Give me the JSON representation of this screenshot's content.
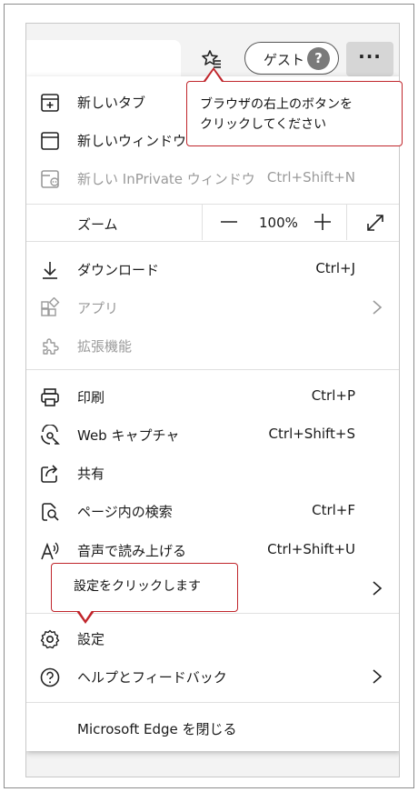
{
  "toolbar": {
    "favorites_icon": "favorites-star-icon",
    "profile_label": "ゲスト",
    "avatar_glyph": "?",
    "more_label": "···"
  },
  "menu": {
    "new_tab": "新しいタブ",
    "new_window": "新しいウィンドウ",
    "new_inprivate": "新しい InPrivate ウィンドウ",
    "new_inprivate_shortcut": "Ctrl+Shift+N",
    "zoom_label": "ズーム",
    "zoom_value": "100%",
    "downloads": "ダウンロード",
    "downloads_shortcut": "Ctrl+J",
    "apps": "アプリ",
    "extensions": "拡張機能",
    "print": "印刷",
    "print_shortcut": "Ctrl+P",
    "web_capture": "Web キャプチャ",
    "web_capture_shortcut": "Ctrl+Shift+S",
    "share": "共有",
    "find": "ページ内の検索",
    "find_shortcut": "Ctrl+F",
    "read_aloud": "音声で読み上げる",
    "read_aloud_shortcut": "Ctrl+Shift+U",
    "settings": "設定",
    "help": "ヘルプとフィードバック",
    "close_edge": "Microsoft Edge を閉じる"
  },
  "callouts": {
    "top_line1": "ブラウザの右上のボタンを",
    "top_line2": "クリックしてください",
    "settings": "設定をクリックします"
  },
  "colors": {
    "callout_border": "#c0252b",
    "disabled_text": "#9a9a9a"
  }
}
